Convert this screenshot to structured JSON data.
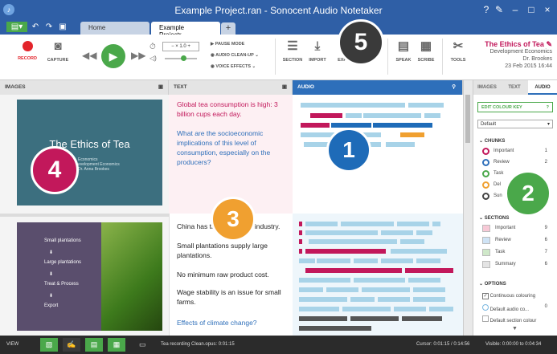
{
  "window": {
    "title": "Example Project.ran - Sonocent Audio Notetaker",
    "min": "–",
    "max": "□",
    "close": "×",
    "help": "?",
    "edit": "✎"
  },
  "tabs": [
    {
      "label": "Home"
    },
    {
      "label": "Example Projectr..."
    }
  ],
  "ribbon": {
    "record": "RECORD",
    "capture": "CAPTURE",
    "speed": "1.0",
    "pause_mode": "PAUSE MODE",
    "audio_cleanup": "AUDIO CLEAN-UP",
    "voice_effects": "VOICE EFFECTS",
    "section": "SECTION",
    "import": "IMPORT",
    "export": "EXPO...",
    "speak": "SPEAK",
    "scribe": "SCRIBE",
    "tools": "TOOLS"
  },
  "project": {
    "title": "The Ethics of Tea",
    "subject": "Development Economics",
    "author": "Dr. Brookes",
    "date": "23 Feb 2015 16:44"
  },
  "panes": {
    "images": "IMAGES",
    "text": "TEXT",
    "audio": "AUDIO"
  },
  "slides": [
    {
      "title": "The Ethics of Tea",
      "sub1": "Economics",
      "sub2": "evelopment Economics",
      "sub3": "Dr. Anna Brookes"
    },
    {
      "flow": [
        "Small plantations",
        "Large plantations",
        "Treat & Process",
        "Export"
      ],
      "arrow": "⬇"
    }
  ],
  "text_notes": {
    "block1": [
      "Global tea consumption is high: 3 billion cups each day.",
      "What are the socioeconomic implications of this level of consumption, especially on the producers?"
    ],
    "block2": [
      "China has the largest tea industry.",
      "Small plantations supply large plantations.",
      "No minimum raw product cost.",
      "Wage stability is an issue for small farms.",
      "Effects of climate change?"
    ]
  },
  "sidebar": {
    "tabs": [
      "IMAGES",
      "TEXT",
      "AUDIO"
    ],
    "edit_colour_key": "EDIT COLOUR KEY",
    "dropdown": "Default",
    "chunks_title": "CHUNKS",
    "chunks": [
      {
        "label": "Important",
        "count": "1",
        "color": "#c2185b"
      },
      {
        "label": "Review",
        "count": "2",
        "color": "#2e6fba"
      },
      {
        "label": "Task",
        "count": "",
        "color": "#4aa84a"
      },
      {
        "label": "Del",
        "count": "",
        "color": "#f0a030"
      },
      {
        "label": "Sun",
        "count": "",
        "color": "#444444"
      }
    ],
    "sections_title": "SECTIONS",
    "sections": [
      {
        "label": "Important",
        "count": "9",
        "color": "#f7c9d6"
      },
      {
        "label": "Review",
        "count": "6",
        "color": "#cfe3f5"
      },
      {
        "label": "Task",
        "count": "7",
        "color": "#cfe8c9"
      },
      {
        "label": "Summary",
        "count": "6",
        "color": "#e4e4e4"
      }
    ],
    "options_title": "OPTIONS",
    "options": [
      {
        "label": "Continuous colouring",
        "checked": "✓"
      },
      {
        "label": "Default audio co...",
        "count": "0"
      },
      {
        "label": "Default section colour"
      }
    ]
  },
  "status": {
    "view": "VIEW",
    "file": "Tea recording Clean.opus: 0:01:15",
    "cursor": "Cursor: 0:01:15 / 0:14:56",
    "visible": "Visible: 0:00:00 to 0:04:34"
  },
  "badges": [
    "1",
    "2",
    "3",
    "4",
    "5"
  ]
}
